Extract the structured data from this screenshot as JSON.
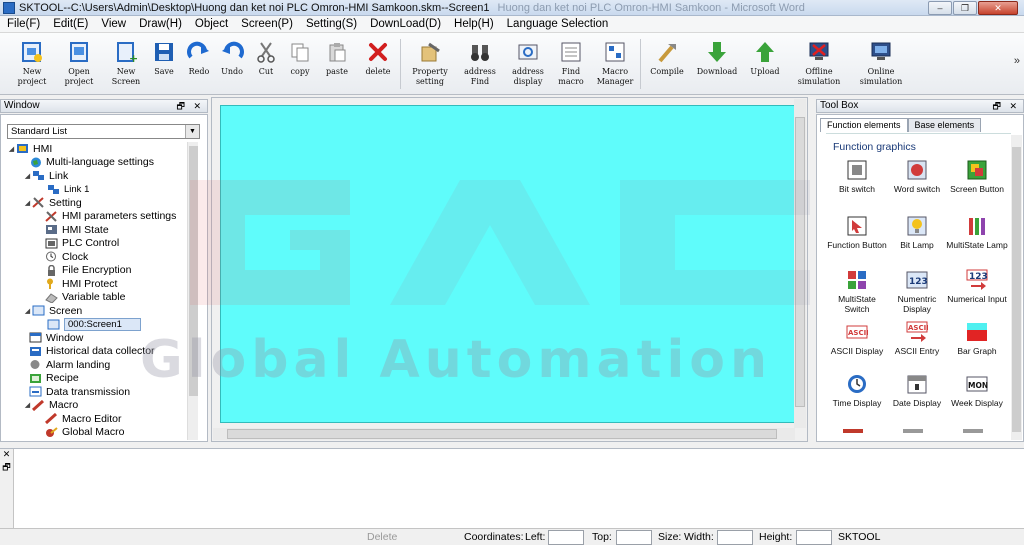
{
  "window": {
    "title": "SKTOOL--C:\\Users\\Admin\\Desktop\\Huong dan ket noi PLC Omron-HMI Samkoon.skm--Screen1",
    "background_title": "Huong dan ket noi PLC Omron-HMI Samkoon - Microsoft Word",
    "min_glyph": "–",
    "max_glyph": "❐",
    "close_glyph": "✕"
  },
  "menu": [
    {
      "label": "File(F)"
    },
    {
      "label": "Edit(E)"
    },
    {
      "label": "View"
    },
    {
      "label": "Draw(H)"
    },
    {
      "label": "Object"
    },
    {
      "label": "Screen(P)"
    },
    {
      "label": "Setting(S)"
    },
    {
      "label": "DownLoad(D)"
    },
    {
      "label": "Help(H)"
    },
    {
      "label": "Language Selection"
    }
  ],
  "toolbar": {
    "more": "»",
    "items": [
      {
        "line1": "New",
        "line2": "project",
        "icon": "new-project-icon"
      },
      {
        "line1": "Open",
        "line2": "project",
        "icon": "open-project-icon"
      },
      {
        "line1": "New",
        "line2": "Screen",
        "icon": "new-screen-icon"
      },
      {
        "line1": "Save",
        "line2": "",
        "icon": "save-icon"
      },
      {
        "line1": "Redo",
        "line2": "",
        "icon": "redo-icon"
      },
      {
        "line1": "Undo",
        "line2": "",
        "icon": "undo-icon"
      },
      {
        "line1": "Cut",
        "line2": "",
        "icon": "cut-icon"
      },
      {
        "line1": "copy",
        "line2": "",
        "icon": "copy-icon"
      },
      {
        "line1": "paste",
        "line2": "",
        "icon": "paste-icon"
      },
      {
        "line1": "delete",
        "line2": "",
        "icon": "delete-icon"
      },
      {
        "line1": "Property",
        "line2": "setting",
        "icon": "property-icon"
      },
      {
        "line1": "address",
        "line2": "Find",
        "icon": "binoculars-icon"
      },
      {
        "line1": "address",
        "line2": "display",
        "icon": "address-display-icon"
      },
      {
        "line1": "Find",
        "line2": "macro",
        "icon": "find-macro-icon"
      },
      {
        "line1": "Macro",
        "line2": "Manager",
        "icon": "macro-manager-icon"
      },
      {
        "line1": "Compile",
        "line2": "",
        "icon": "compile-icon"
      },
      {
        "line1": "Download",
        "line2": "",
        "icon": "download-icon"
      },
      {
        "line1": "Upload",
        "line2": "",
        "icon": "upload-icon"
      },
      {
        "line1": "Offline",
        "line2": "simulation",
        "icon": "offline-sim-icon"
      },
      {
        "line1": "Online",
        "line2": "simulation",
        "icon": "online-sim-icon"
      }
    ]
  },
  "left_panel": {
    "title": "Window",
    "buttons": "🗗 ✕",
    "combo": "Standard List",
    "tree": [
      {
        "label": "HMI",
        "toggle": "◢",
        "icon": "hmi-icon"
      },
      {
        "label": "Multi-language settings",
        "toggle": "",
        "icon": "globe-icon"
      },
      {
        "label": "Link",
        "toggle": "◢",
        "icon": "link-icon"
      },
      {
        "label": "Link 1",
        "toggle": "",
        "icon": "link-item-icon"
      },
      {
        "label": "Setting",
        "toggle": "◢",
        "icon": "setting-icon"
      },
      {
        "label": "HMI parameters settings",
        "toggle": "",
        "icon": "tools-icon"
      },
      {
        "label": "HMI State",
        "toggle": "",
        "icon": "state-icon"
      },
      {
        "label": "PLC Control",
        "toggle": "",
        "icon": "plc-icon"
      },
      {
        "label": "Clock",
        "toggle": "",
        "icon": "clock-icon"
      },
      {
        "label": "File Encryption",
        "toggle": "",
        "icon": "lock-icon"
      },
      {
        "label": "HMI Protect",
        "toggle": "",
        "icon": "key-icon"
      },
      {
        "label": "Variable table",
        "toggle": "",
        "icon": "table-icon"
      },
      {
        "label": "Screen",
        "toggle": "◢",
        "icon": "screen-icon"
      },
      {
        "label": "000:Screen1",
        "toggle": "",
        "icon": "screen-item-icon"
      },
      {
        "label": "Window",
        "toggle": "",
        "icon": "window-icon"
      },
      {
        "label": "Historical data collector",
        "toggle": "",
        "icon": "history-icon"
      },
      {
        "label": "Alarm landing",
        "toggle": "",
        "icon": "alarm-icon"
      },
      {
        "label": "Recipe",
        "toggle": "",
        "icon": "recipe-icon"
      },
      {
        "label": "Data transmission",
        "toggle": "",
        "icon": "transmission-icon"
      },
      {
        "label": "Macro",
        "toggle": "◢",
        "icon": "macro-icon"
      },
      {
        "label": "Macro Editor",
        "toggle": "",
        "icon": "macro-editor-icon"
      },
      {
        "label": "Global Macro",
        "toggle": "",
        "icon": "global-macro-icon"
      }
    ]
  },
  "right_panel": {
    "title": "Tool Box",
    "buttons": "🗗 ✕",
    "tabs": [
      {
        "label": "Function elements"
      },
      {
        "label": "Base elements"
      }
    ],
    "section": "Function graphics",
    "tools": [
      {
        "label": "Bit switch",
        "icon": "bit-switch-icon"
      },
      {
        "label": "Word switch",
        "icon": "word-switch-icon"
      },
      {
        "label": "Screen Button",
        "icon": "screen-button-icon"
      },
      {
        "label": "Function Button",
        "icon": "function-button-icon"
      },
      {
        "label": "Bit Lamp",
        "icon": "bit-lamp-icon"
      },
      {
        "label": "MultiState Lamp",
        "icon": "multistate-lamp-icon"
      },
      {
        "label": "MultiState Switch",
        "icon": "multistate-switch-icon"
      },
      {
        "label": "Numentric Display",
        "icon": "numeric-display-icon",
        "badge": "123"
      },
      {
        "label": "Numerical Input",
        "icon": "numeric-input-icon",
        "badge": "123"
      },
      {
        "label": "ASCII Display",
        "icon": "ascii-display-icon",
        "badge": "ASCII"
      },
      {
        "label": "ASCII Entry",
        "icon": "ascii-entry-icon",
        "badge": "ASCII"
      },
      {
        "label": "Bar Graph",
        "icon": "bar-graph-icon"
      },
      {
        "label": "Time Display",
        "icon": "time-display-icon"
      },
      {
        "label": "Date Display",
        "icon": "date-display-icon"
      },
      {
        "label": "Week Display",
        "icon": "week-display-icon",
        "badge": "MON"
      }
    ]
  },
  "output_panel": {
    "buttons": "✕ 🗗"
  },
  "statusbar": {
    "delete": "Delete",
    "coordinates": "Coordinates:",
    "left": "Left:",
    "top": "Top:",
    "size": "Size:",
    "width": "Width:",
    "height": "Height:",
    "app": "SKTOOL"
  },
  "watermark": {
    "text": "Global Automation"
  },
  "colors": {
    "screen_bg": "#5ffcfb",
    "accent": "#2a6cc4"
  }
}
